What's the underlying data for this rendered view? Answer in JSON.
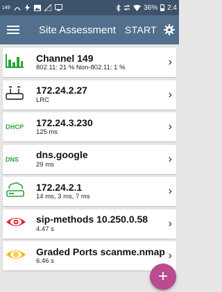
{
  "status_bar": {
    "signal_badge": "149",
    "battery": "36%",
    "time": "2:4"
  },
  "app_bar": {
    "title": "Site Assessment",
    "start_label": "START"
  },
  "cards": [
    {
      "icon": "signal-bars-icon",
      "title": "Channel 149",
      "subtitle": "802.11:  21 %   Non-802.11:  1 %"
    },
    {
      "icon": "router-icon",
      "title": "172.24.2.27",
      "subtitle": "LRC"
    },
    {
      "icon": "dhcp-icon",
      "icon_text": "DHCP",
      "title": "172.24.3.230",
      "subtitle": "125 ms"
    },
    {
      "icon": "dns-icon",
      "icon_text": "DNS",
      "title": "dns.google",
      "subtitle": "29 ms"
    },
    {
      "icon": "gateway-icon",
      "title": "172.24.2.1",
      "subtitle": "14 ms,  3 ms,  7 ms"
    },
    {
      "icon": "eye-red-icon",
      "title": "sip-methods 10.250.0.58",
      "subtitle": "4.47 s"
    },
    {
      "icon": "eye-yellow-icon",
      "title": "Graded Ports scanme.nmap",
      "subtitle": "6.46 s"
    }
  ],
  "fab_label": "+",
  "colors": {
    "status_bar": "#3c536b",
    "app_bar": "#526f8d",
    "green": "#2aa43a",
    "red": "#d32f2f",
    "yellow": "#f5b800",
    "fab": "#b94b8f"
  }
}
